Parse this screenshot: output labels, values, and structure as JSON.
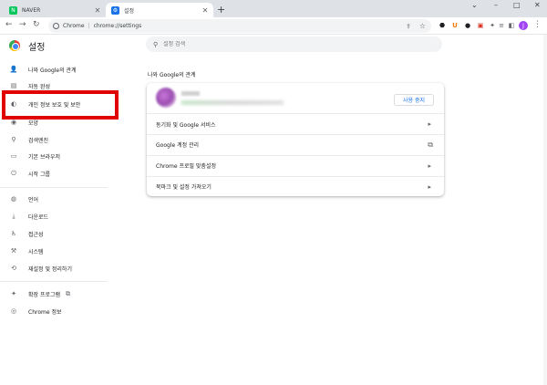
{
  "tabs": [
    {
      "title": "NAVER",
      "favicon_color": "#03c75a",
      "favicon_glyph": "N"
    },
    {
      "title": "설정",
      "favicon_color": "#1a73e8",
      "favicon_glyph": "⚙"
    }
  ],
  "window_controls": {
    "dropdown": "⌄",
    "minimize": "–",
    "maximize": "□",
    "close": "✕"
  },
  "toolbar": {
    "back": "←",
    "forward": "→",
    "reload": "↻",
    "url_host": "Chrome",
    "url_sep": "|",
    "url_path": "chrome://settings",
    "share": "⇪",
    "star": "☆",
    "extensions": [
      {
        "name": "bolt-extension",
        "glyph": "⬣",
        "color": "#202124"
      },
      {
        "name": "u-extension",
        "glyph": "U",
        "color": "#f57c00"
      },
      {
        "name": "dark-extension",
        "glyph": "●",
        "color": "#202124"
      },
      {
        "name": "red-extension",
        "glyph": "▣",
        "color": "#d93025"
      },
      {
        "name": "puzzle-extension",
        "glyph": "✦",
        "color": "#5f6368"
      },
      {
        "name": "playlist-extension",
        "glyph": "≡",
        "color": "#5f6368"
      },
      {
        "name": "sidepanel-extension",
        "glyph": "◧",
        "color": "#5f6368"
      }
    ],
    "avatar_letter": "J",
    "menu": "⋮"
  },
  "header": {
    "title": "설정"
  },
  "search": {
    "placeholder": "설정 검색",
    "icon": "⚲"
  },
  "sidebar": {
    "items": [
      {
        "name": "sidebar-item-you-and-google",
        "label": "나와 Google의 관계",
        "icon": "👤",
        "icon_name": "person-icon"
      },
      {
        "name": "sidebar-item-autofill",
        "label": "자동 완성",
        "icon": "▤",
        "icon_name": "clipboard-icon"
      },
      {
        "name": "sidebar-item-privacy",
        "label": "개인 정보 보호 및 보안",
        "icon": "◐",
        "icon_name": "shield-icon"
      },
      {
        "name": "sidebar-item-appearance",
        "label": "모양",
        "icon": "◉",
        "icon_name": "palette-icon"
      },
      {
        "name": "sidebar-item-search-engine",
        "label": "검색엔진",
        "icon": "⚲",
        "icon_name": "search-icon"
      },
      {
        "name": "sidebar-item-default-browser",
        "label": "기본 브라우저",
        "icon": "▭",
        "icon_name": "browser-icon"
      },
      {
        "name": "sidebar-item-on-startup",
        "label": "시작 그룹",
        "icon": "⏻",
        "icon_name": "power-icon"
      },
      {
        "name": "sidebar-item-languages",
        "label": "언어",
        "icon": "◍",
        "icon_name": "globe-icon"
      },
      {
        "name": "sidebar-item-downloads",
        "label": "다운로드",
        "icon": "⤓",
        "icon_name": "download-icon"
      },
      {
        "name": "sidebar-item-accessibility",
        "label": "접근성",
        "icon": "♿",
        "icon_name": "accessibility-icon"
      },
      {
        "name": "sidebar-item-system",
        "label": "시스템",
        "icon": "⚒",
        "icon_name": "wrench-icon"
      },
      {
        "name": "sidebar-item-reset",
        "label": "재설정 및 정리하기",
        "icon": "⟲",
        "icon_name": "history-icon"
      },
      {
        "name": "sidebar-item-extensions",
        "label": "확장 프로그램",
        "icon": "✦",
        "icon_name": "puzzle-icon",
        "external": "⧉"
      },
      {
        "name": "sidebar-item-about",
        "label": "Chrome 정보",
        "icon": "◎",
        "icon_name": "chrome-icon"
      }
    ]
  },
  "main": {
    "section_title": "나와 Google의 관계",
    "sync_button": "사용 중지",
    "rows": [
      {
        "label": "동기화 및 Google 서비스",
        "arrow": "▸"
      },
      {
        "label": "Google 계정 관리",
        "arrow": "⧉"
      },
      {
        "label": "Chrome 프로필 맞춤설정",
        "arrow": "▸"
      },
      {
        "label": "북마크 및 설정 가져오기",
        "arrow": "▸"
      }
    ]
  },
  "colors": {
    "highlight": "#e10000",
    "accent": "#1a73e8"
  }
}
